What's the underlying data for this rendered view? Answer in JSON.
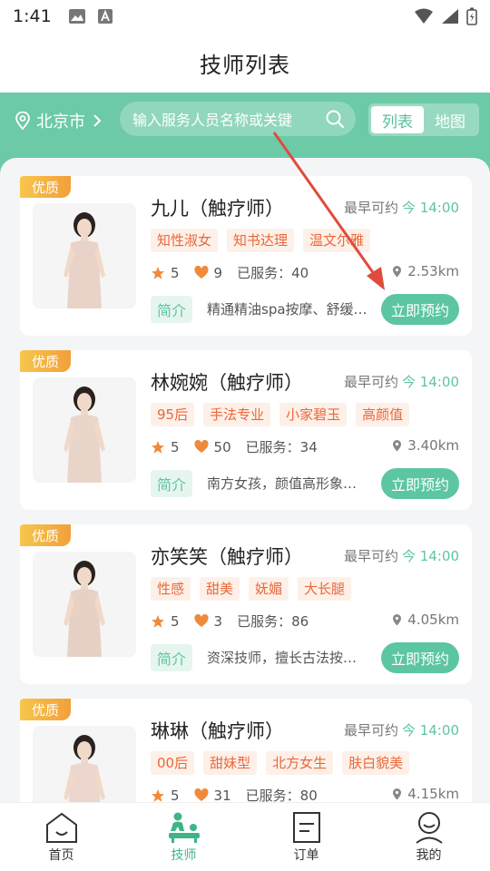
{
  "status_bar": {
    "time": "1:41"
  },
  "header": {
    "title": "技师列表"
  },
  "search": {
    "city": "北京市",
    "placeholder": "输入服务人员名称或关键",
    "view_list": "列表",
    "view_map": "地图"
  },
  "common": {
    "earliest_label": "最早可约",
    "intro_label": "简介",
    "book_label": "立即预约",
    "served_label": "已服务："
  },
  "technicians": [
    {
      "badge": "优质",
      "name": "九儿（触疗师）",
      "time": "今 14:00",
      "tags": [
        "知性淑女",
        "知书达理",
        "温文尔雅"
      ],
      "rating": "5",
      "likes": "9",
      "served": "40",
      "distance": "2.53km",
      "intro": "精通精油spa按摩、舒缓…"
    },
    {
      "badge": "优质",
      "name": "林婉婉（触疗师）",
      "time": "今 14:00",
      "tags": [
        "95后",
        "手法专业",
        "小家碧玉",
        "高颜值"
      ],
      "rating": "5",
      "likes": "50",
      "served": "34",
      "distance": "3.40km",
      "intro": "南方女孩，颜值高形象…"
    },
    {
      "badge": "优质",
      "name": "亦笑笑（触疗师）",
      "time": "今 14:00",
      "tags": [
        "性感",
        "甜美",
        "妩媚",
        "大长腿"
      ],
      "rating": "5",
      "likes": "3",
      "served": "86",
      "distance": "4.05km",
      "intro": "资深技师，擅长古法按…"
    },
    {
      "badge": "优质",
      "name": "琳琳（触疗师）",
      "time": "今 14:00",
      "tags": [
        "00后",
        "甜妹型",
        "北方女生",
        "肤白貌美"
      ],
      "rating": "5",
      "likes": "31",
      "served": "80",
      "distance": "4.15km",
      "intro": ""
    }
  ],
  "tab_bar": {
    "tabs": [
      {
        "label": "首页",
        "icon": "home-icon"
      },
      {
        "label": "技师",
        "icon": "massage-icon"
      },
      {
        "label": "订单",
        "icon": "order-icon"
      },
      {
        "label": "我的",
        "icon": "profile-icon"
      }
    ],
    "active_index": 1
  },
  "colors": {
    "brand": "#6ccaa7",
    "accent_button": "#5cc5a2",
    "tag_text": "#e9683b",
    "badge": "#f2a03a",
    "annotation_arrow": "#e04b3d"
  }
}
